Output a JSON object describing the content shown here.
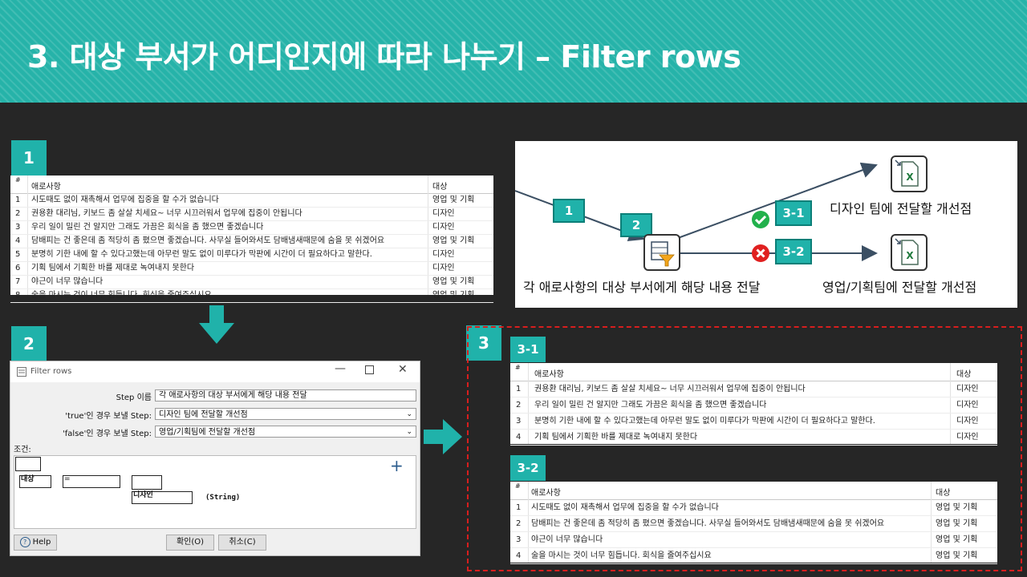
{
  "slide": {
    "title": "3. 대상 부서가 어디인지에 따라 나누기 – Filter rows",
    "badges": {
      "b1": "1",
      "b2": "2",
      "b3": "3",
      "b31": "3-1",
      "b32": "3-2"
    }
  },
  "table1": {
    "headers": {
      "index": "#",
      "col1": "애로사항",
      "col2": "대상"
    },
    "rows": [
      {
        "n": "1",
        "text": "시도때도 없이 재촉해서 업무에 집중을 할 수가 없습니다",
        "target": "영업 및 기획"
      },
      {
        "n": "2",
        "text": "권용환 대리님, 키보드 좀 살살 치세요~ 너무 시끄러워서 업무에 집중이 안됩니다",
        "target": "디자인"
      },
      {
        "n": "3",
        "text": "우리 일이 밀린 건 알지만 그래도 가끔은 회식을 좀 했으면 좋겠습니다",
        "target": "디자인"
      },
      {
        "n": "4",
        "text": "담배피는 건 좋은데 좀 적당히 좀 폈으면 좋겠습니다. 사무실 들어와서도 담배냄새때문에 숨을 못 쉬겠어요",
        "target": "영업 및 기획"
      },
      {
        "n": "5",
        "text": "분명히 기한 내에 할 수 있다고했는데 아무런 말도 없이 미루다가 막판에 시간이 더 필요하다고 말한다.",
        "target": "디자인"
      },
      {
        "n": "6",
        "text": "기획 팀에서 기획한 바를 제대로 녹여내지 못한다",
        "target": "디자인"
      },
      {
        "n": "7",
        "text": "야근이 너무 많습니다",
        "target": "영업 및 기획"
      },
      {
        "n": "8",
        "text": "술을 마시는 것이 너무 힘듭니다. 회식을 줄여주십시요",
        "target": "영업 및 기획"
      }
    ]
  },
  "dialog": {
    "title": "Filter rows",
    "step_name_label": "Step 이름",
    "step_name_value": "각 애로사항의 대상 부서에게 해당 내용 전달",
    "true_label": "'true'인 경우 보낼 Step:",
    "true_value": "디자인 팀에 전달할 개선점",
    "false_label": "'false'인 경우 보낼 Step:",
    "false_value": "영업/기획팀에 전달할 개선점",
    "condition_label": "조건:",
    "field": "대상",
    "operator": "=",
    "value": "디자인",
    "value_type": "(String)",
    "help": "Help",
    "ok": "확인(O)",
    "cancel": "취소(C)",
    "plus": "+"
  },
  "diagram": {
    "badge1": "1",
    "badge2": "2",
    "badge31": "3-1",
    "badge32": "3-2",
    "source_label": "각 애로사항의 대상 부서에게 해당 내용 전달",
    "true_target": "디자인 팀에 전달할 개선점",
    "false_target": "영업/기획팀에 전달할 개선점",
    "excel_glyph": "X"
  },
  "table31": {
    "headers": {
      "index": "#",
      "col1": "애로사항",
      "col2": "대상"
    },
    "rows": [
      {
        "n": "1",
        "text": "권용환 대리님, 키보드 좀 살살 치세요~ 너무 시끄러워서 업무에 집중이 안됩니다",
        "target": "디자인"
      },
      {
        "n": "2",
        "text": "우리 일이 밀린 건 알지만 그래도 가끔은 회식을 좀 했으면 좋겠습니다",
        "target": "디자인"
      },
      {
        "n": "3",
        "text": "분명히 기한 내에 할 수 있다고했는데 아무런 말도 없이 미루다가 막판에 시간이 더 필요하다고 말한다.",
        "target": "디자인"
      },
      {
        "n": "4",
        "text": "기획 팀에서 기획한 바를 제대로 녹여내지 못한다",
        "target": "디자인"
      }
    ]
  },
  "table32": {
    "headers": {
      "index": "#",
      "col1": "애로사항",
      "col2": "대상"
    },
    "rows": [
      {
        "n": "1",
        "text": "시도때도 없이 재촉해서 업무에 집중을 할 수가 없습니다",
        "target": "영업 및 기획"
      },
      {
        "n": "2",
        "text": "담배피는 건 좋은데 좀 적당히 좀 폈으면 좋겠습니다. 사무실 들어와서도 담배냄새때문에 숨을 못 쉬겠어요",
        "target": "영업 및 기획"
      },
      {
        "n": "3",
        "text": "야근이 너무 많습니다",
        "target": "영업 및 기획"
      },
      {
        "n": "4",
        "text": "술을 마시는 것이 너무 힘듭니다. 회식을 줄여주십시요",
        "target": "영업 및 기획"
      }
    ]
  },
  "colors": {
    "teal": "#20b2aa",
    "header": "#26b3a9",
    "background": "#262626",
    "dash": "#d81e1e",
    "ok": "#22b14c",
    "fail": "#e02020"
  }
}
